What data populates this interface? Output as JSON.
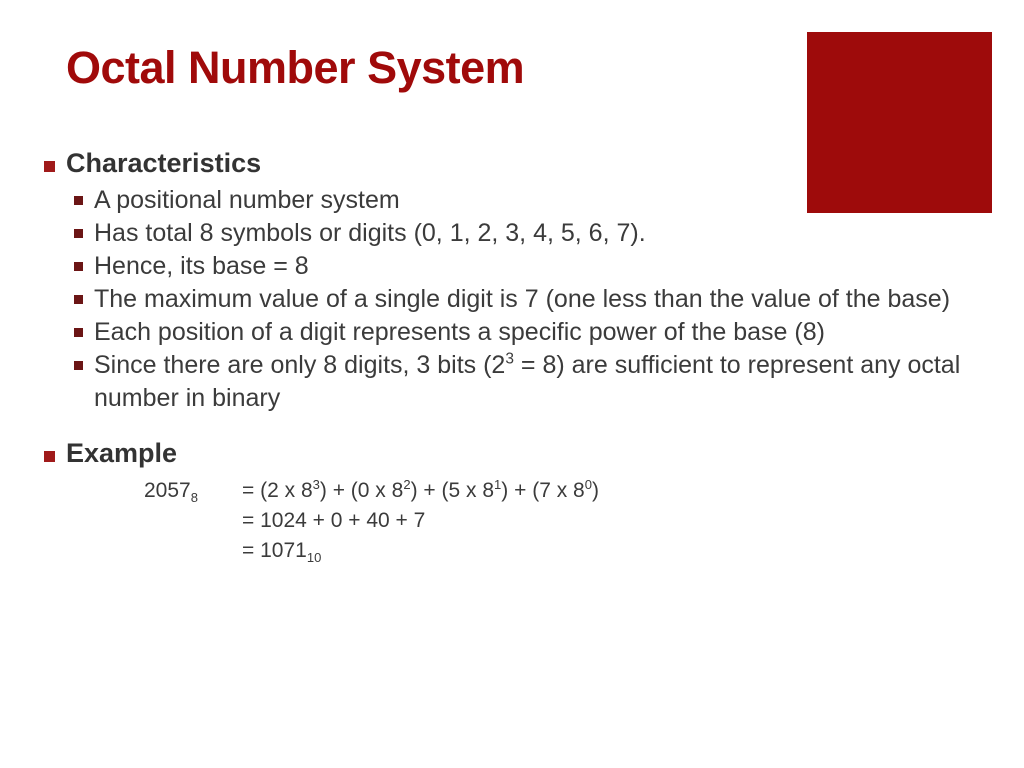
{
  "slide": {
    "title": "Octal Number System",
    "accent_color": "#A00A0A",
    "deco_color": "#9E0B0B",
    "bullet_l1_color": "#A01A1A",
    "bullet_l2_color": "#6B1515",
    "body_color": "#3B3B3B",
    "heading_color": "#333333"
  },
  "sections": {
    "characteristics": {
      "heading": "Characteristics",
      "items": [
        "A positional number system",
        "Has total 8 symbols or digits (0, 1, 2, 3, 4, 5, 6, 7).",
        "Hence, its base = 8",
        "The maximum value of a single digit is 7 (one less than the value of the base)",
        "Each position of a digit represents a specific power of the base (8)"
      ],
      "item_with_superscript": {
        "before": "Since there are only 8 digits, 3 bits (2",
        "sup": "3",
        "after": " = 8) are sufficient to represent any octal number in binary"
      }
    },
    "example": {
      "heading": "Example",
      "number": "2057",
      "number_sub": "8",
      "lines": [
        {
          "parts": [
            {
              "text": "= (2 x 8"
            },
            {
              "sup": "3"
            },
            {
              "text": ") + (0 x 8"
            },
            {
              "sup": "2"
            },
            {
              "text": ") + (5 x 8"
            },
            {
              "sup": "1"
            },
            {
              "text": ") + (7 x 8"
            },
            {
              "sup": "0"
            },
            {
              "text": ")"
            }
          ],
          "plain": "= (2 x 8^3) + (0 x 8^2) + (5 x 8^1) + (7 x 8^0)"
        },
        {
          "plain": "= 1024 + 0 + 40 + 7"
        },
        {
          "plain": "= 1071",
          "sub": "10"
        }
      ]
    }
  }
}
